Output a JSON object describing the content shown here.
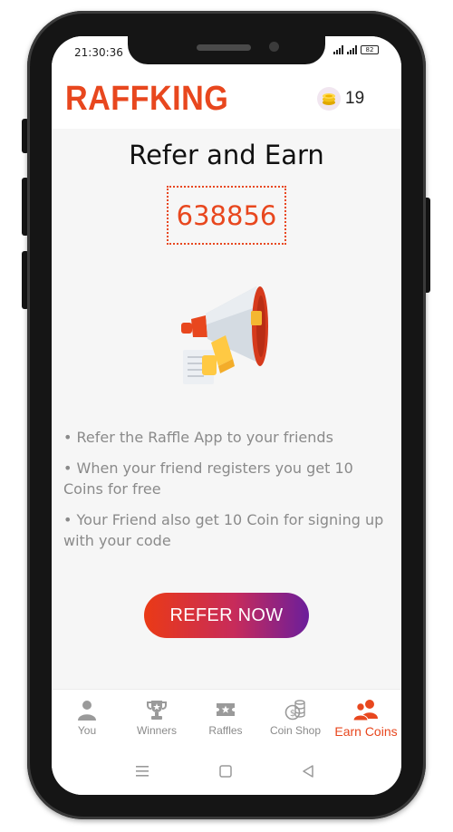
{
  "status_bar": {
    "time": "21:30:36",
    "battery": "82"
  },
  "app": {
    "brand": "RAFFKING",
    "coins": "19",
    "accent_color": "#e8471e"
  },
  "main": {
    "title": "Refer and Earn",
    "referral_code": "638856",
    "bullets": [
      "• Refer the Raffle App to your friends",
      "• When your friend registers you get 10 Coins for free",
      "• Your Friend also get 10 Coin for signing up with your code"
    ],
    "refer_button": "REFER NOW"
  },
  "bottom_nav": {
    "items": [
      {
        "label": "You",
        "icon": "person-icon"
      },
      {
        "label": "Winners",
        "icon": "trophy-icon"
      },
      {
        "label": "Raffles",
        "icon": "ticket-icon"
      },
      {
        "label": "Coin Shop",
        "icon": "coin-shop-icon"
      },
      {
        "label": "Earn Coins",
        "icon": "group-icon",
        "active": true
      }
    ]
  },
  "system_nav": {
    "buttons": [
      "menu-icon",
      "home-icon",
      "back-icon"
    ]
  }
}
